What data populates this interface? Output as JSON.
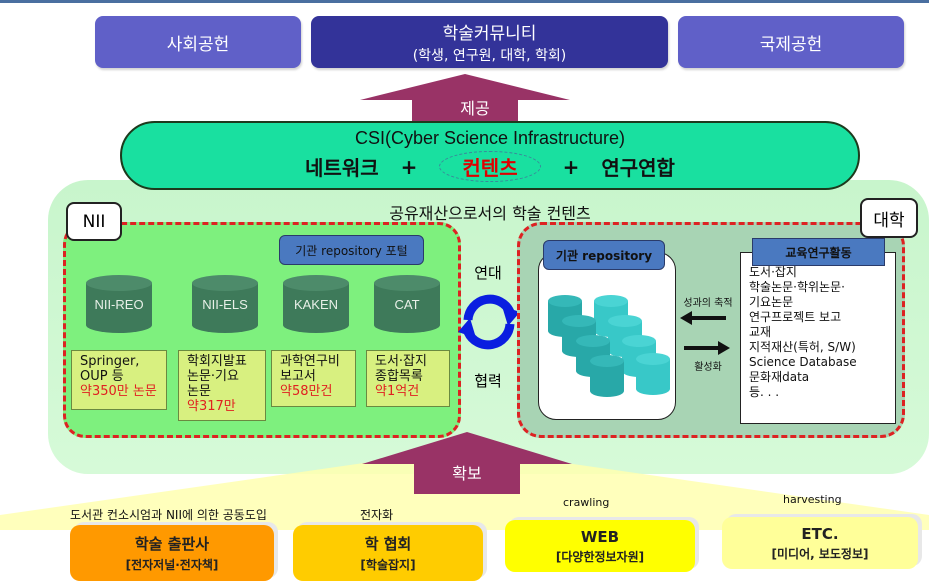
{
  "top_boxes": [
    {
      "line1": "사회공헌",
      "line2": ""
    },
    {
      "line1": "학술커뮤니티",
      "line2": "(학생, 연구원, 대학, 학회)"
    },
    {
      "line1": "국제공헌",
      "line2": ""
    }
  ],
  "arrow_provide": "제공",
  "arrow_secure": "확보",
  "csi": {
    "title": "CSI(Cyber Science Infrastructure)",
    "network": "네트워크",
    "plus": "+",
    "contents": "컨텐츠",
    "research": "연구연합"
  },
  "shared_title": "공유재산으로서의 학술 컨텐츠",
  "nii": {
    "label": "NII",
    "portal": "기관 repository 포털",
    "databases": [
      "NII-REO",
      "NII-ELS",
      "KAKEN",
      "CAT"
    ],
    "info": [
      {
        "lines": [
          "Springer,",
          "OUP 등"
        ],
        "count": "약350만 논문"
      },
      {
        "lines": [
          "학회지발표",
          "논문·기요",
          "논문"
        ],
        "count": "약317만"
      },
      {
        "lines": [
          "과학연구비",
          "보고서"
        ],
        "count": "약58만건"
      },
      {
        "lines": [
          "도서·잡지",
          "종합목록"
        ],
        "count": "약1억건"
      }
    ]
  },
  "link": {
    "top": "연대",
    "bottom": "협력"
  },
  "university": {
    "label": "대학",
    "repo_title": "기관 repository",
    "arrow_left_label": "성과의 축적",
    "arrow_right_label": "활성화",
    "edu_title": "교육연구활동",
    "edu_items": [
      "도서·잡지",
      "학술논문·학위논문·",
      "기요논문",
      "연구프로젝트 보고",
      "교재",
      "지적재산(특허, S/W)",
      "Science Database",
      "문화재data",
      "등. . ."
    ]
  },
  "sources": [
    {
      "label": "도서관 컨소시엄과 NII에 의한 공동도입",
      "main": "학술 출판사",
      "sub": "[전자저널·전자책]",
      "color": "#ff9900"
    },
    {
      "label": "전자화",
      "main": "학 협회",
      "sub": "[학술잡지]",
      "color": "#ffcc00"
    },
    {
      "label": "crawling",
      "main": "WEB",
      "sub": "[다양한정보자원]",
      "color": "#ffff00"
    },
    {
      "label": "harvesting",
      "main": "ETC.",
      "sub": "[미디어, 보도정보]",
      "color": "#ffff99"
    }
  ],
  "colors": {
    "arrow": "#993366",
    "csi_fill": "#19e0a0",
    "dashed_border": "#dd2222",
    "box_blue": "#4a79c0"
  }
}
